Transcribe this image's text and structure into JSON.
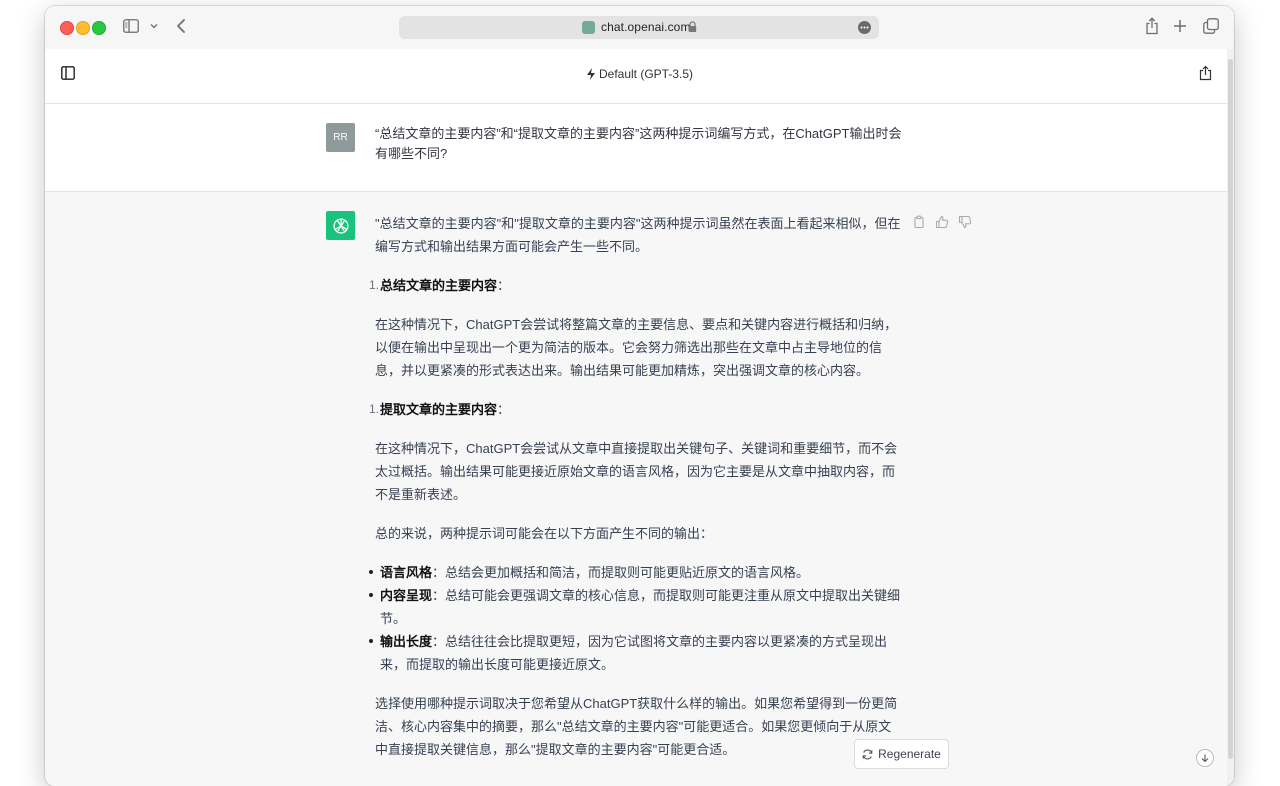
{
  "browser": {
    "url": "chat.openai.com"
  },
  "header": {
    "model_label": "Default (GPT-3.5)"
  },
  "user_message": {
    "avatar_initials": "RR",
    "text": "“总结文章的主要内容”和“提取文章的主要内容”这两种提示词编写方式，在ChatGPT输出时会有哪些不同?"
  },
  "assistant_message": {
    "intro": "\"总结文章的主要内容\"和\"提取文章的主要内容\"这两种提示词虽然在表面上看起来相似，但在编写方式和输出结果方面可能会产生一些不同。",
    "sections": [
      {
        "number": "1.",
        "title": "总结文章的主要内容",
        "colon": "：",
        "body": "在这种情况下，ChatGPT会尝试将整篇文章的主要信息、要点和关键内容进行概括和归纳，以便在输出中呈现出一个更为简洁的版本。它会努力筛选出那些在文章中占主导地位的信息，并以更紧凑的形式表达出来。输出结果可能更加精炼，突出强调文章的核心内容。"
      },
      {
        "number": "1.",
        "title": "提取文章的主要内容",
        "colon": "：",
        "body": "在这种情况下，ChatGPT会尝试从文章中直接提取出关键句子、关键词和重要细节，而不会太过概括。输出结果可能更接近原始文章的语言风格，因为它主要是从文章中抽取内容，而不是重新表述。"
      }
    ],
    "summary_lead": "总的来说，两种提示词可能会在以下方面产生不同的输出：",
    "bullets": [
      {
        "term": "语言风格",
        "sep": "：",
        "text": "总结会更加概括和简洁，而提取则可能更贴近原文的语言风格。"
      },
      {
        "term": "内容呈现",
        "sep": "：",
        "text": "总结可能会更强调文章的核心信息，而提取则可能更注重从原文中提取出关键细节。"
      },
      {
        "term": "输出长度",
        "sep": "：",
        "text": "总结往往会比提取更短，因为它试图将文章的主要内容以更紧凑的方式呈现出来，而提取的输出长度可能更接近原文。"
      }
    ],
    "conclusion": "选择使用哪种提示词取决于您希望从ChatGPT获取什么样的输出。如果您希望得到一份更简洁、核心内容集中的摘要，那么\"总结文章的主要内容\"可能更适合。如果您更倾向于从原文中直接提取关键信息，那么\"提取文章的主要内容\"可能更合适。"
  },
  "controls": {
    "regenerate_label": "Regenerate"
  },
  "colors": {
    "accent": "#19c37d",
    "user_avatar": "#8f9a9b",
    "assistant_bg": "#f7f7f8"
  }
}
